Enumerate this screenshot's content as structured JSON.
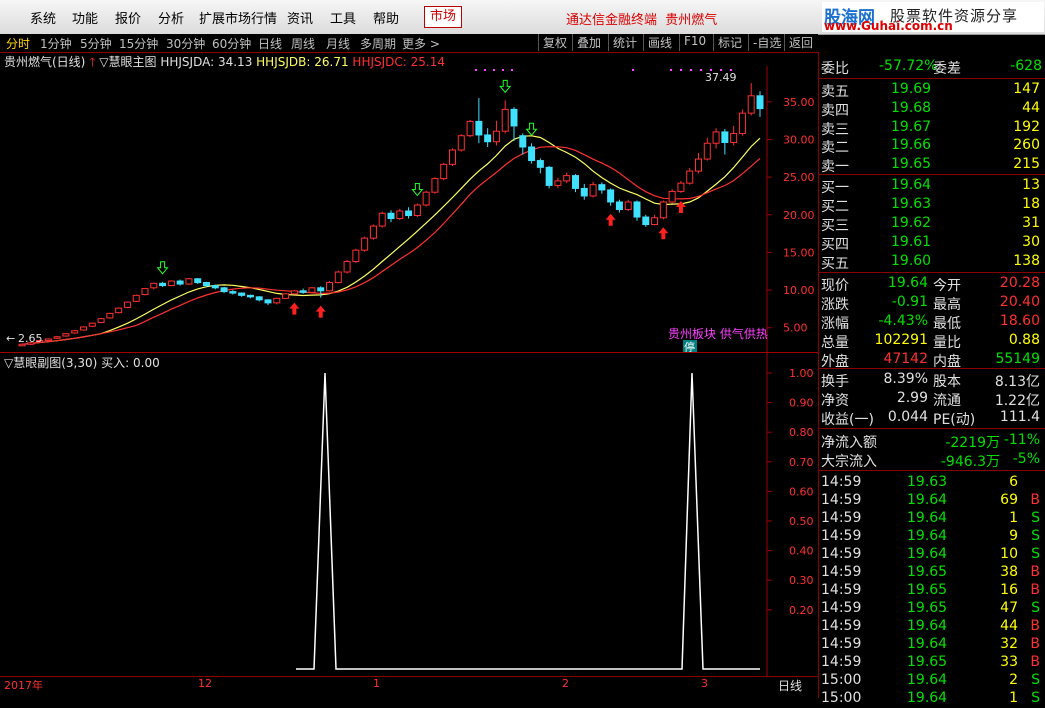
{
  "menu": [
    "系统",
    "功能",
    "报价",
    "分析",
    "扩展市场行情",
    "资讯",
    "工具",
    "帮助"
  ],
  "market_btn": "市场",
  "app_title": "通达信金融终端",
  "stock_title": "贵州燃气",
  "logo": {
    "brand": "股海网",
    "tagline": "股票软件资源分享",
    "url": "www.Guhai.com.cn"
  },
  "periods": [
    "分时",
    "1分钟",
    "5分钟",
    "15分钟",
    "30分钟",
    "60分钟",
    "日线",
    "周线",
    "月线",
    "多周期",
    "更多 >"
  ],
  "tools": [
    "复权",
    "叠加",
    "统计",
    "画线",
    "F10",
    "标记",
    "-自选",
    "返回"
  ],
  "main": {
    "stock": "贵州燃气(日线)",
    "indicator": "▽慧眼主图",
    "ind_a": "HHJSJDA: 34.13",
    "ind_b": "HHJSJDB: 26.71",
    "ind_c": "HHJSJDC: 25.14",
    "price_ticks": [
      "35.00",
      "30.00",
      "25.00",
      "20.00",
      "15.00",
      "10.00",
      "5.00"
    ],
    "high_label": "37.49",
    "low_label": "2.65",
    "annotation": "贵州板块 供气供热",
    "limit_badge": "停",
    "colors": {
      "up": "#ff3030",
      "down": "#40e0ff",
      "ma1": "#ffff60",
      "ma2": "#ff3030"
    }
  },
  "sub": {
    "indicator": "▽慧眼副图(3,30)",
    "buy": "买入: 0.00",
    "ticks": [
      "1.00",
      "0.90",
      "0.80",
      "0.70",
      "0.60",
      "0.50",
      "0.40",
      "0.30",
      "0.20"
    ],
    "peaks": [
      0.0,
      1.0,
      0.0,
      1.0,
      0.0
    ]
  },
  "dates": [
    "2017年",
    "12",
    "1",
    "2",
    "3"
  ],
  "date_period": "日线",
  "quote": {
    "wb_label": "委比",
    "wb_value": "-57.72%",
    "wc_label": "委差",
    "wc_value": "-628",
    "asks": [
      [
        "卖五",
        "19.69",
        "147"
      ],
      [
        "卖四",
        "19.68",
        "44"
      ],
      [
        "卖三",
        "19.67",
        "192"
      ],
      [
        "卖二",
        "19.66",
        "260"
      ],
      [
        "卖一",
        "19.65",
        "215"
      ]
    ],
    "bids": [
      [
        "买一",
        "19.64",
        "13"
      ],
      [
        "买二",
        "19.63",
        "18"
      ],
      [
        "买三",
        "19.62",
        "31"
      ],
      [
        "买四",
        "19.61",
        "30"
      ],
      [
        "买五",
        "19.60",
        "138"
      ]
    ],
    "stats": [
      [
        "现价",
        "19.64",
        "今开",
        "20.28"
      ],
      [
        "涨跌",
        "-0.91",
        "最高",
        "20.40"
      ],
      [
        "涨幅",
        "-4.43%",
        "最低",
        "18.60"
      ],
      [
        "总量",
        "102291",
        "量比",
        "0.88"
      ],
      [
        "外盘",
        "47142",
        "内盘",
        "55149"
      ]
    ],
    "stats2": [
      [
        "换手",
        "8.39%",
        "股本",
        "8.13亿"
      ],
      [
        "净资",
        "2.99",
        "流通",
        "1.22亿"
      ],
      [
        "收益(一)",
        "0.044",
        "PE(动)",
        "111.4"
      ]
    ],
    "flow": [
      [
        "净流入额",
        "-2219万",
        "-11%"
      ],
      [
        "大宗流入",
        "-946.3万",
        "-5%"
      ]
    ],
    "ticks": [
      [
        "14:59",
        "19.63",
        "6",
        ""
      ],
      [
        "14:59",
        "19.64",
        "69",
        "B"
      ],
      [
        "14:59",
        "19.64",
        "1",
        "S"
      ],
      [
        "14:59",
        "19.64",
        "9",
        "S"
      ],
      [
        "14:59",
        "19.64",
        "10",
        "S"
      ],
      [
        "14:59",
        "19.65",
        "38",
        "B"
      ],
      [
        "14:59",
        "19.65",
        "16",
        "B"
      ],
      [
        "14:59",
        "19.65",
        "47",
        "S"
      ],
      [
        "14:59",
        "19.64",
        "44",
        "B"
      ],
      [
        "14:59",
        "19.64",
        "32",
        "B"
      ],
      [
        "14:59",
        "19.65",
        "33",
        "B"
      ],
      [
        "15:00",
        "19.64",
        "2",
        "S"
      ],
      [
        "15:00",
        "19.64",
        "1",
        "S"
      ]
    ]
  },
  "candles": [
    [
      2.6,
      2.8,
      2.5,
      2.9
    ],
    [
      2.8,
      3.0,
      2.7,
      3.1
    ],
    [
      3.1,
      3.3,
      3.0,
      3.4
    ],
    [
      3.3,
      3.5,
      3.2,
      3.6
    ],
    [
      3.6,
      3.8,
      3.5,
      3.9
    ],
    [
      3.9,
      4.2,
      3.8,
      4.3
    ],
    [
      4.3,
      4.6,
      4.2,
      4.7
    ],
    [
      4.7,
      5.1,
      4.6,
      5.2
    ],
    [
      5.2,
      5.6,
      5.1,
      5.7
    ],
    [
      5.7,
      6.2,
      5.6,
      6.3
    ],
    [
      6.3,
      6.9,
      6.2,
      7.0
    ],
    [
      7.0,
      7.6,
      6.9,
      7.7
    ],
    [
      7.7,
      8.4,
      7.6,
      8.5
    ],
    [
      8.5,
      9.3,
      8.4,
      9.4
    ],
    [
      9.4,
      10.2,
      9.3,
      10.3
    ],
    [
      10.3,
      10.9,
      10.1,
      11.0
    ],
    [
      10.9,
      10.6,
      10.4,
      11.1
    ],
    [
      10.6,
      11.2,
      10.5,
      11.3
    ],
    [
      11.2,
      10.8,
      10.6,
      11.4
    ],
    [
      10.8,
      11.5,
      10.7,
      11.6
    ],
    [
      11.5,
      11.0,
      10.8,
      11.6
    ],
    [
      11.0,
      10.6,
      10.4,
      11.1
    ],
    [
      10.6,
      10.3,
      10.1,
      10.7
    ],
    [
      10.3,
      9.8,
      9.6,
      10.4
    ],
    [
      9.8,
      9.6,
      9.4,
      10.0
    ],
    [
      9.6,
      9.3,
      9.1,
      9.7
    ],
    [
      9.3,
      9.1,
      8.9,
      9.4
    ],
    [
      9.1,
      8.7,
      8.5,
      9.2
    ],
    [
      8.7,
      8.3,
      8.0,
      8.8
    ],
    [
      8.3,
      8.9,
      8.1,
      9.0
    ],
    [
      8.9,
      9.5,
      8.8,
      9.6
    ],
    [
      9.5,
      9.9,
      9.4,
      10.0
    ],
    [
      9.9,
      9.7,
      9.5,
      10.2
    ],
    [
      9.7,
      10.3,
      9.6,
      10.4
    ],
    [
      10.3,
      9.9,
      9.0,
      10.5
    ],
    [
      9.9,
      11.0,
      9.8,
      11.2
    ],
    [
      11.0,
      12.4,
      10.9,
      12.6
    ],
    [
      12.4,
      13.8,
      12.2,
      14.0
    ],
    [
      13.8,
      15.3,
      13.6,
      15.5
    ],
    [
      15.3,
      16.9,
      15.1,
      17.1
    ],
    [
      16.9,
      18.5,
      16.7,
      18.7
    ],
    [
      18.5,
      20.2,
      18.3,
      20.4
    ],
    [
      20.2,
      19.5,
      19.0,
      20.6
    ],
    [
      19.5,
      20.5,
      19.3,
      20.8
    ],
    [
      20.5,
      19.9,
      19.5,
      21.0
    ],
    [
      19.9,
      21.3,
      19.7,
      21.5
    ],
    [
      21.3,
      23.0,
      21.1,
      23.2
    ],
    [
      23.0,
      24.8,
      22.8,
      25.0
    ],
    [
      24.8,
      26.7,
      24.6,
      26.9
    ],
    [
      26.7,
      28.6,
      26.5,
      28.8
    ],
    [
      28.6,
      30.5,
      28.4,
      30.7
    ],
    [
      30.5,
      32.4,
      30.3,
      32.6
    ],
    [
      32.4,
      30.6,
      29.5,
      35.5
    ],
    [
      30.6,
      29.7,
      29.0,
      31.5
    ],
    [
      29.7,
      31.1,
      29.2,
      32.5
    ],
    [
      31.1,
      34.0,
      30.8,
      35.2
    ],
    [
      34.0,
      31.8,
      29.8,
      34.3
    ],
    [
      30.5,
      29.0,
      28.0,
      30.8
    ],
    [
      29.0,
      27.2,
      26.8,
      29.5
    ],
    [
      27.2,
      26.3,
      25.5,
      27.5
    ],
    [
      26.3,
      23.9,
      23.5,
      26.5
    ],
    [
      23.9,
      24.5,
      23.5,
      24.9
    ],
    [
      24.5,
      25.2,
      24.2,
      25.6
    ],
    [
      25.2,
      23.5,
      23.0,
      25.4
    ],
    [
      23.5,
      22.5,
      22.0,
      24.1
    ],
    [
      22.5,
      24.0,
      22.3,
      24.4
    ],
    [
      24.0,
      23.3,
      22.8,
      24.3
    ],
    [
      23.3,
      21.7,
      21.2,
      23.5
    ],
    [
      21.7,
      20.7,
      20.3,
      22.0
    ],
    [
      20.7,
      21.7,
      20.5,
      22.0
    ],
    [
      21.7,
      19.7,
      19.2,
      21.9
    ],
    [
      19.7,
      18.7,
      18.4,
      20.0
    ],
    [
      18.7,
      19.6,
      18.6,
      20.0
    ],
    [
      19.6,
      21.7,
      19.4,
      21.9
    ],
    [
      21.7,
      23.1,
      21.5,
      23.4
    ],
    [
      23.1,
      24.2,
      22.9,
      24.5
    ],
    [
      24.2,
      25.8,
      24.0,
      26.2
    ],
    [
      25.8,
      27.4,
      25.5,
      28.2
    ],
    [
      27.4,
      29.5,
      27.2,
      30.2
    ],
    [
      29.5,
      31.0,
      28.8,
      31.5
    ],
    [
      31.0,
      29.6,
      28.0,
      31.4
    ],
    [
      29.6,
      30.8,
      29.2,
      31.8
    ],
    [
      30.8,
      33.5,
      30.5,
      34.0
    ],
    [
      33.5,
      35.8,
      33.2,
      37.49
    ],
    [
      35.8,
      34.1,
      33.0,
      36.4
    ]
  ]
}
